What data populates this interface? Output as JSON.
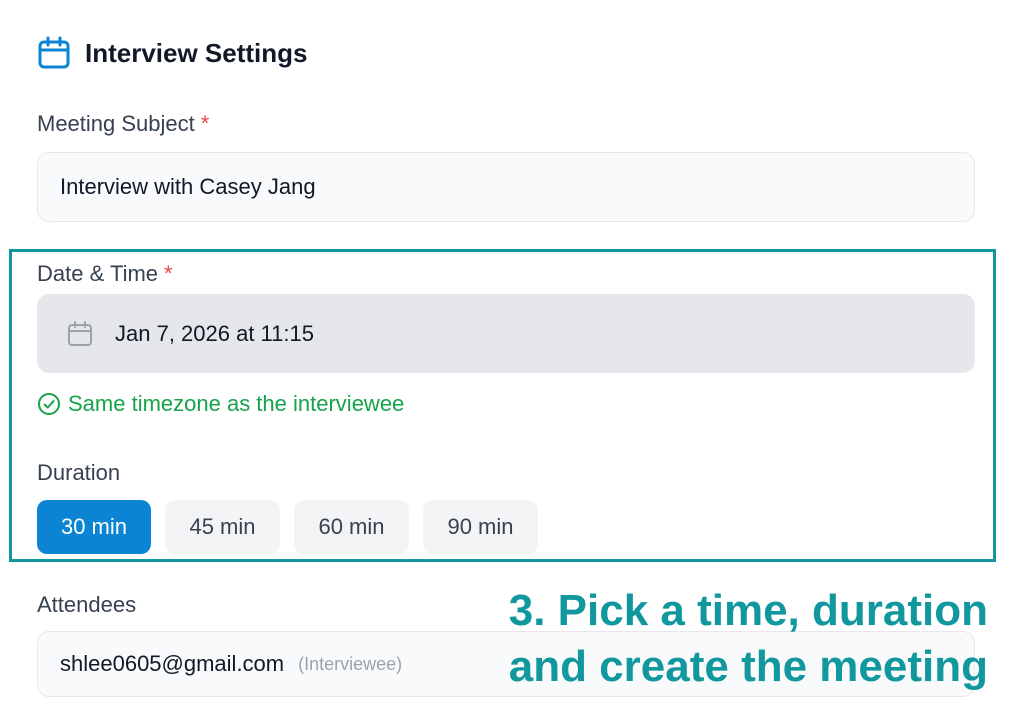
{
  "header": {
    "title": "Interview Settings",
    "icon": "calendar-icon",
    "accent_color": "#0b84d3"
  },
  "subject": {
    "label": "Meeting Subject",
    "required_mark": "*",
    "value": "Interview with Casey Jang"
  },
  "datetime": {
    "label": "Date & Time",
    "required_mark": "*",
    "value": "Jan 7, 2026 at 11:15",
    "icon": "calendar-icon",
    "timezone_note": "Same timezone as the interviewee",
    "timezone_icon": "check-circle-icon"
  },
  "duration": {
    "label": "Duration",
    "options": [
      "30 min",
      "45 min",
      "60 min",
      "90 min"
    ],
    "selected": "30 min"
  },
  "attendees": {
    "label": "Attendees",
    "items": [
      {
        "email": "shlee0605@gmail.com",
        "role": "(Interviewee)"
      }
    ]
  },
  "overlay": {
    "caption_line1": "3. Pick a time, duration",
    "caption_line2": "and create the meeting",
    "highlight_color": "#11979e"
  },
  "colors": {
    "success": "#16a34a",
    "required": "#ef4444"
  }
}
